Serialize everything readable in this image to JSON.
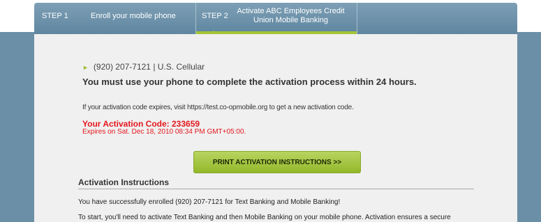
{
  "steps": [
    {
      "num": "STEP 1",
      "label": "Enroll your mobile phone"
    },
    {
      "num": "STEP 2",
      "label": "Activate ABC Employees Credit Union Mobile Banking"
    }
  ],
  "phone_line": "(920) 207-7121 | U.S. Cellular",
  "must_use_text": "You must use your phone to complete the activation process within 24 hours.",
  "expires_note": "If your activation code expires, visit https://test.co-opmobile.org to get a new activation code.",
  "activation_code": "Your Activation Code: 233659",
  "code_expires": "Expires on Sat. Dec 18, 2010 08:34 PM GMT+05:00.",
  "print_button": "PRINT ACTIVATION INSTRUCTIONS >>",
  "instructions_heading": "Activation Instructions",
  "instructions_lines": [
    "You have successfully enrolled (920) 207-7121 for Text Banking and Mobile Banking!",
    "To start, you'll need to activate Text Banking and then Mobile Banking on your mobile phone. Activation ensures a secure"
  ],
  "colors": {
    "background_blue": "#6b8fa7",
    "accent_green": "#a4c436",
    "code_red": "#e4161c"
  },
  "icons": {
    "phone_bullet": "triangle-right-icon"
  }
}
